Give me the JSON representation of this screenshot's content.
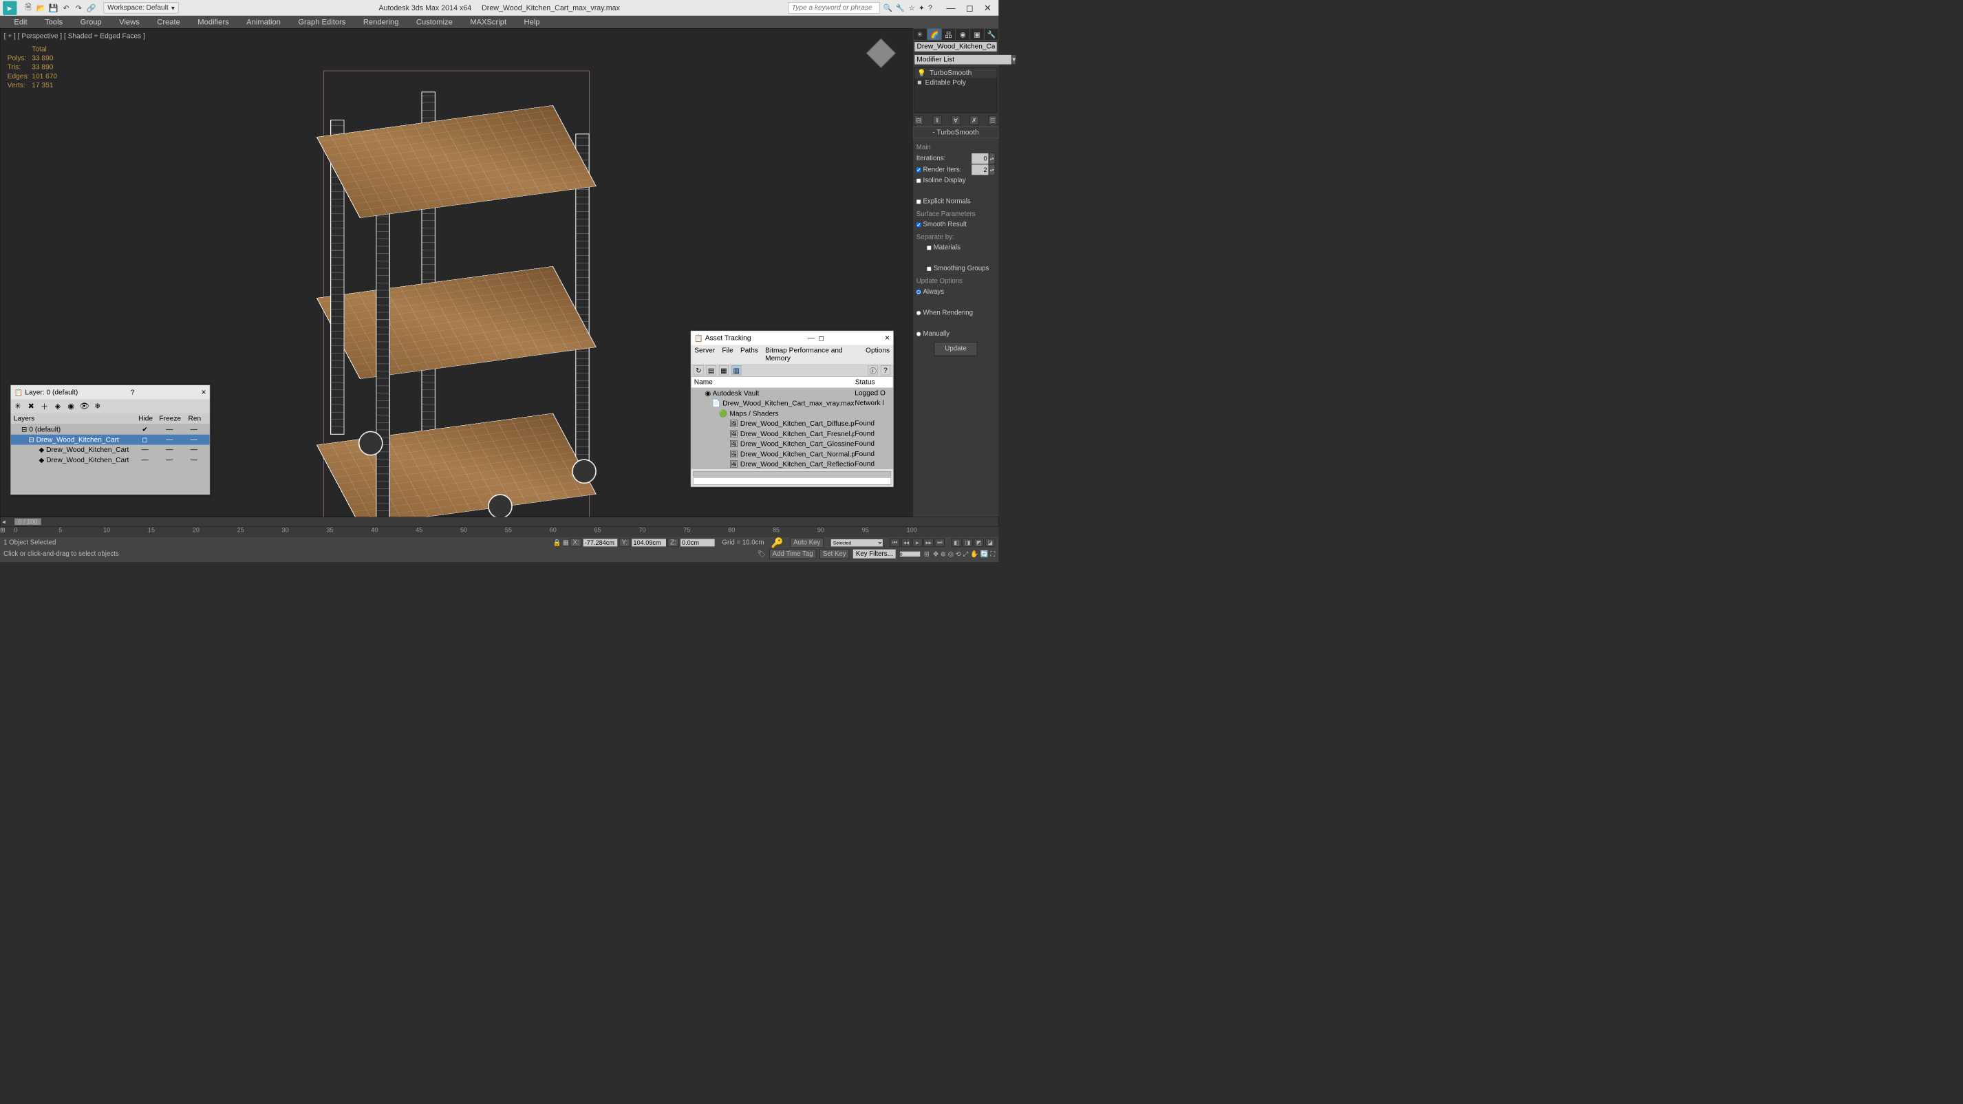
{
  "titlebar": {
    "workspace_label": "Workspace: Default",
    "app_name": "Autodesk 3ds Max  2014 x64",
    "file_name": "Drew_Wood_Kitchen_Cart_max_vray.max",
    "search_placeholder": "Type a keyword or phrase"
  },
  "menu": [
    "Edit",
    "Tools",
    "Group",
    "Views",
    "Create",
    "Modifiers",
    "Animation",
    "Graph Editors",
    "Rendering",
    "Customize",
    "MAXScript",
    "Help"
  ],
  "viewport": {
    "label": "[ + ] [ Perspective ] [ Shaded + Edged Faces ]",
    "stats_title": "Total",
    "stats": [
      {
        "label": "Polys:",
        "value": "33 890"
      },
      {
        "label": "Tris:",
        "value": "33 890"
      },
      {
        "label": "Edges:",
        "value": "101 670"
      },
      {
        "label": "Verts:",
        "value": "17 351"
      }
    ]
  },
  "command_panel": {
    "object_name": "Drew_Wood_Kitchen_Cart",
    "modifier_list": "Modifier List",
    "stack": [
      {
        "icon": "💡",
        "name": "TurboSmooth"
      },
      {
        "icon": "■",
        "name": "Editable Poly"
      }
    ],
    "rollout_title": "TurboSmooth",
    "main_label": "Main",
    "iterations_label": "Iterations:",
    "iterations_value": "0",
    "render_iters_label": "Render Iters:",
    "render_iters_value": "2",
    "isoline_label": "Isoline Display",
    "explicit_label": "Explicit Normals",
    "surface_label": "Surface Parameters",
    "smooth_result_label": "Smooth Result",
    "separate_label": "Separate by:",
    "materials_label": "Materials",
    "smoothing_label": "Smoothing Groups",
    "update_options_label": "Update Options",
    "always_label": "Always",
    "when_rendering_label": "When Rendering",
    "manually_label": "Manually",
    "update_button": "Update"
  },
  "layer_dialog": {
    "title": "Layer: 0 (default)",
    "help": "?",
    "columns": [
      "Layers",
      "Hide",
      "Freeze",
      "Ren"
    ],
    "rows": [
      {
        "name": "0 (default)",
        "indent": 20,
        "selected": false,
        "check": true
      },
      {
        "name": "Drew_Wood_Kitchen_Cart",
        "indent": 40,
        "selected": true,
        "box": true
      },
      {
        "name": "Drew_Wood_Kitchen_Cart",
        "indent": 60,
        "selected": false
      },
      {
        "name": "Drew_Wood_Kitchen_Cart",
        "indent": 60,
        "selected": false
      }
    ]
  },
  "asset_dialog": {
    "title": "Asset Tracking",
    "menu": [
      "Server",
      "File",
      "Paths",
      "Bitmap Performance and Memory",
      "Options"
    ],
    "columns": [
      "Name",
      "Status"
    ],
    "rows": [
      {
        "name": "Autodesk Vault",
        "status": "Logged O",
        "indent": 30
      },
      {
        "name": "Drew_Wood_Kitchen_Cart_max_vray.max",
        "status": "Network l",
        "indent": 50
      },
      {
        "name": "Maps / Shaders",
        "status": "",
        "indent": 70
      },
      {
        "name": "Drew_Wood_Kitchen_Cart_Diffuse.png",
        "status": "Found",
        "indent": 100
      },
      {
        "name": "Drew_Wood_Kitchen_Cart_Fresnel.png",
        "status": "Found",
        "indent": 100
      },
      {
        "name": "Drew_Wood_Kitchen_Cart_Glossiness.png",
        "status": "Found",
        "indent": 100
      },
      {
        "name": "Drew_Wood_Kitchen_Cart_Normal.png",
        "status": "Found",
        "indent": 100
      },
      {
        "name": "Drew_Wood_Kitchen_Cart_Reflection.png",
        "status": "Found",
        "indent": 100
      }
    ]
  },
  "timeline": {
    "slider_label": "0 / 100",
    "ticks": [
      "0",
      "5",
      "10",
      "15",
      "20",
      "25",
      "30",
      "35",
      "40",
      "45",
      "50",
      "55",
      "60",
      "65",
      "70",
      "75",
      "80",
      "85",
      "90",
      "95",
      "100"
    ],
    "selection_status": "1 Object Selected",
    "x_val": "-77.284cm",
    "y_val": "104.09cm",
    "z_val": "0.0cm",
    "grid_label": "Grid = 10.0cm",
    "autokey_label": "Auto Key",
    "selected_label": "Selected",
    "setkey_label": "Set Key",
    "keyfilters_label": "Key Filters...",
    "prompt": "Click or click-and-drag to select objects",
    "add_time_tag": "Add Time Tag"
  }
}
